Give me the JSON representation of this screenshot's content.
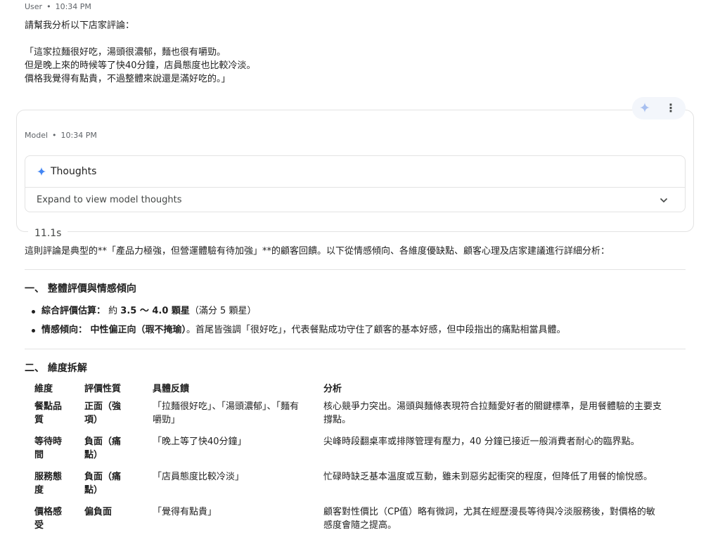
{
  "user": {
    "role": "User",
    "time": "10:34 PM",
    "lines": [
      "請幫我分析以下店家評論：",
      "",
      "「這家拉麵很好吃，湯頭很濃郁，麵也很有嚼勁。",
      "但是晚上來的時候等了快40分鐘，店員態度也比較冷淡。",
      "價格我覺得有點貴，不過整體來說還是滿好吃的。」"
    ]
  },
  "actions": {
    "spark_icon": "sparkle-icon",
    "more": "⋮"
  },
  "model": {
    "role": "Model",
    "time": "10:34 PM",
    "thoughts_title": "Thoughts",
    "thoughts_expand": "Expand to view model thoughts",
    "elapsed": "11.1s"
  },
  "response": {
    "intro": "這則評論是典型的**「產品力極強，但營運體驗有待加強」**的顧客回饋。以下從情感傾向、各維度優缺點、顧客心理及店家建議進行詳細分析：",
    "section1": {
      "title": "一、 整體評價與情感傾向",
      "b1_label": "綜合評價估算：",
      "b1_pre": " 約 ",
      "b1_bold": "3.5 ～ 4.0 顆星",
      "b1_post": "（滿分 5 顆星）",
      "b2_label": "情感傾向：",
      "b2_bold": " 中性偏正向（瑕不掩瑜）",
      "b2_post": "。首尾皆強調「很好吃」，代表餐點成功守住了顧客的基本好感，但中段指出的痛點相當具體。"
    },
    "section2": {
      "title": "二、 維度拆解",
      "headers": [
        "維度",
        "評價性質",
        "具體反饋",
        "分析"
      ],
      "rows": [
        {
          "dim_a": "餐點品",
          "dim_b": "質",
          "nature_a": "正面（強",
          "nature_b": "項）",
          "feedback_a": "「拉麵很好吃」、「湯頭濃郁」、「麵有",
          "feedback_b": "嚼勁」",
          "analysis_a": "核心競爭力突出。湯頭與麵條表現符合拉麵愛好者的關鍵標準，是用餐體驗的主要支",
          "analysis_b": "撐點。"
        },
        {
          "dim_a": "等待時",
          "dim_b": "間",
          "nature_a": "負面（痛",
          "nature_b": "點）",
          "feedback_a": "「晚上等了快40分鐘」",
          "feedback_b": "",
          "analysis_a": "尖峰時段翻桌率或排隊管理有壓力，40 分鐘已接近一般消費者耐心的臨界點。",
          "analysis_b": ""
        },
        {
          "dim_a": "服務態",
          "dim_b": "度",
          "nature_a": "負面（痛",
          "nature_b": "點）",
          "feedback_a": "「店員態度比較冷淡」",
          "feedback_b": "",
          "analysis_a": "忙碌時缺乏基本溫度或互動，雖未到惡劣起衝突的程度，但降低了用餐的愉悅感。",
          "analysis_b": ""
        },
        {
          "dim_a": "價格感",
          "dim_b": "受",
          "nature_a": "偏負面",
          "nature_b": "",
          "feedback_a": "「覺得有點貴」",
          "feedback_b": "",
          "analysis_a": "顧客對性價比（CP值）略有微詞，尤其在經歷漫長等待與冷淡服務後，對價格的敏",
          "analysis_b": "感度會隨之提高。"
        }
      ]
    }
  }
}
